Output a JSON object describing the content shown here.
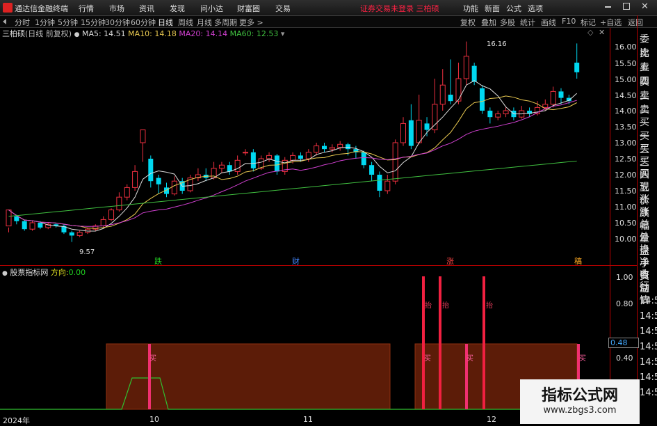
{
  "app": {
    "name": "通达信金融终端",
    "menus": [
      "行情",
      "市场",
      "资讯",
      "发现",
      "问小达",
      "财富圈",
      "交易"
    ],
    "status": "证券交易未登录",
    "status_name": "三柏硕",
    "right_menus": [
      "功能",
      "新面",
      "公式",
      "选项"
    ]
  },
  "periods": [
    "分时",
    "1分钟",
    "5分钟",
    "15分钟",
    "30分钟",
    "60分钟",
    "日线",
    "周线",
    "月线",
    "多周期",
    "更多"
  ],
  "active_period": "日线",
  "period_more_arrow": ">",
  "toolbar": [
    "复权",
    "叠加",
    "多股",
    "统计",
    "画线",
    "F10",
    "标记",
    "+自选",
    "返回"
  ],
  "info": {
    "title": "三柏硕",
    "mode": "(日线 前复权)",
    "ma5": "MA5: 14.51",
    "ma10": "MA10: 14.18",
    "ma20": "MA20: 14.14",
    "ma60": "MA60: 12.53"
  },
  "side_labels": [
    "委比",
    "卖五",
    "卖四",
    "卖三",
    "卖二",
    "卖一",
    "买一",
    "买二",
    "买三",
    "买四",
    "买五",
    "现价",
    "涨跌",
    "涨幅",
    "总量",
    "外盘",
    "换手",
    "净资",
    "收益",
    "自动",
    "行情"
  ],
  "side_times": [
    "14:5",
    "14:5",
    "14:5",
    "14:5",
    "14:5",
    "14:5",
    "14:5"
  ],
  "price_labels": [
    "16.00",
    "15.50",
    "15.00",
    "14.50",
    "14.00",
    "13.50",
    "13.00",
    "12.50",
    "12.00",
    "11.50",
    "11.00",
    "10.50",
    "10.00"
  ],
  "high_label": "16.16",
  "low_label": "9.57",
  "markers": [
    {
      "t": "跌",
      "c": "#2c2"
    },
    {
      "t": "财",
      "c": "#48f"
    },
    {
      "t": "涨",
      "c": "#f44"
    },
    {
      "t": "稿",
      "c": "#fa2"
    }
  ],
  "indicator": {
    "name": "股票指标网",
    "field": "方向:",
    "value": "0.00",
    "axis": [
      "1.00",
      "0.80",
      "0.40"
    ],
    "current": "0.48",
    "bar_text": "买",
    "peak_text": "抬"
  },
  "time_axis": [
    "2024年",
    "10",
    "11",
    "12"
  ],
  "watermark": {
    "title": "指标公式网",
    "url": "www.zbgs3.com"
  },
  "colors": {
    "up": "#f03040",
    "down": "#00d8f0",
    "ma5": "#dddddd",
    "ma10": "#e8c850",
    "ma20": "#d040d0",
    "ma60": "#40c040"
  },
  "candles": [
    [
      10.4,
      10.9,
      10.35,
      10.2
    ],
    [
      10.7,
      10.55,
      10.75,
      10.45
    ],
    [
      10.55,
      10.3,
      10.6,
      10.25
    ],
    [
      10.3,
      10.5,
      10.55,
      10.25
    ],
    [
      10.5,
      10.35,
      10.55,
      10.3
    ],
    [
      10.35,
      10.45,
      10.5,
      10.3
    ],
    [
      10.45,
      10.4,
      10.5,
      10.35
    ],
    [
      10.4,
      10.2,
      10.45,
      10.15
    ],
    [
      10.2,
      10.1,
      10.25,
      9.9
    ],
    [
      10.1,
      10.2,
      10.25,
      10.05
    ],
    [
      10.2,
      10.3,
      10.35,
      10.15
    ],
    [
      10.3,
      10.4,
      10.45,
      10.25
    ],
    [
      10.4,
      10.6,
      10.7,
      10.35
    ],
    [
      10.6,
      10.9,
      10.95,
      10.55
    ],
    [
      10.9,
      11.3,
      11.45,
      10.85
    ],
    [
      11.3,
      11.6,
      11.7,
      11.2
    ],
    [
      11.6,
      12.1,
      12.3,
      11.5
    ],
    [
      13.0,
      13.4,
      13.4,
      12.4
    ],
    [
      12.5,
      11.8,
      12.6,
      11.6
    ],
    [
      11.9,
      11.7,
      12.0,
      11.4
    ],
    [
      11.6,
      11.4,
      11.75,
      11.3
    ],
    [
      11.4,
      11.8,
      11.95,
      11.35
    ],
    [
      11.8,
      11.5,
      11.9,
      11.4
    ],
    [
      11.5,
      11.9,
      12.0,
      11.45
    ],
    [
      11.9,
      12.0,
      12.2,
      11.8
    ],
    [
      12.0,
      11.9,
      12.2,
      11.8
    ],
    [
      11.9,
      12.2,
      12.4,
      11.85
    ],
    [
      12.2,
      12.3,
      12.4,
      12.05
    ],
    [
      12.3,
      12.1,
      12.4,
      12.0
    ],
    [
      12.1,
      12.45,
      12.6,
      12.0
    ],
    [
      12.7,
      12.7,
      12.8,
      12.6
    ],
    [
      12.7,
      12.2,
      12.8,
      12.1
    ],
    [
      12.2,
      12.5,
      12.6,
      12.15
    ],
    [
      12.5,
      12.6,
      12.7,
      12.4
    ],
    [
      12.6,
      12.1,
      12.65,
      12.0
    ],
    [
      12.1,
      12.45,
      12.55,
      12.0
    ],
    [
      12.45,
      12.6,
      12.7,
      12.35
    ],
    [
      12.6,
      12.5,
      12.7,
      12.4
    ],
    [
      12.5,
      12.7,
      12.8,
      12.4
    ],
    [
      12.7,
      12.9,
      13.0,
      12.6
    ],
    [
      12.9,
      12.8,
      13.0,
      12.7
    ],
    [
      12.8,
      12.85,
      12.95,
      12.7
    ],
    [
      12.85,
      12.95,
      13.05,
      12.75
    ],
    [
      12.95,
      12.8,
      13.0,
      12.6
    ],
    [
      12.8,
      12.7,
      12.9,
      12.5
    ],
    [
      12.7,
      12.3,
      12.75,
      12.2
    ],
    [
      12.3,
      12.0,
      12.4,
      11.8
    ],
    [
      12.0,
      11.5,
      12.1,
      11.3
    ],
    [
      11.5,
      11.8,
      12.0,
      11.4
    ],
    [
      11.8,
      13.0,
      13.1,
      11.7
    ],
    [
      13.0,
      13.6,
      13.8,
      12.9
    ],
    [
      13.7,
      12.9,
      14.2,
      12.8
    ],
    [
      13.0,
      13.7,
      14.5,
      12.95
    ],
    [
      13.6,
      13.4,
      13.8,
      13.2
    ],
    [
      13.4,
      14.2,
      15.0,
      13.3
    ],
    [
      14.2,
      14.8,
      15.3,
      14.0
    ],
    [
      14.5,
      14.3,
      15.6,
      14.2
    ],
    [
      14.3,
      15.0,
      15.5,
      14.2
    ],
    [
      15.0,
      15.7,
      16.16,
      14.8
    ],
    [
      15.4,
      14.9,
      15.5,
      14.8
    ],
    [
      14.7,
      14.0,
      14.8,
      13.9
    ],
    [
      14.0,
      13.8,
      14.1,
      13.6
    ],
    [
      13.8,
      13.9,
      14.0,
      13.7
    ],
    [
      13.9,
      14.0,
      14.1,
      13.8
    ],
    [
      14.0,
      13.8,
      14.1,
      13.7
    ],
    [
      13.8,
      14.0,
      14.15,
      13.75
    ],
    [
      14.0,
      13.9,
      14.1,
      13.8
    ],
    [
      13.9,
      14.1,
      14.3,
      13.85
    ],
    [
      14.1,
      14.2,
      14.35,
      14.0
    ],
    [
      14.2,
      14.6,
      14.75,
      14.1
    ],
    [
      14.6,
      14.4,
      14.7,
      14.2
    ],
    [
      14.4,
      14.3,
      14.5,
      14.2
    ],
    [
      15.5,
      15.2,
      16.1,
      15.0
    ]
  ]
}
